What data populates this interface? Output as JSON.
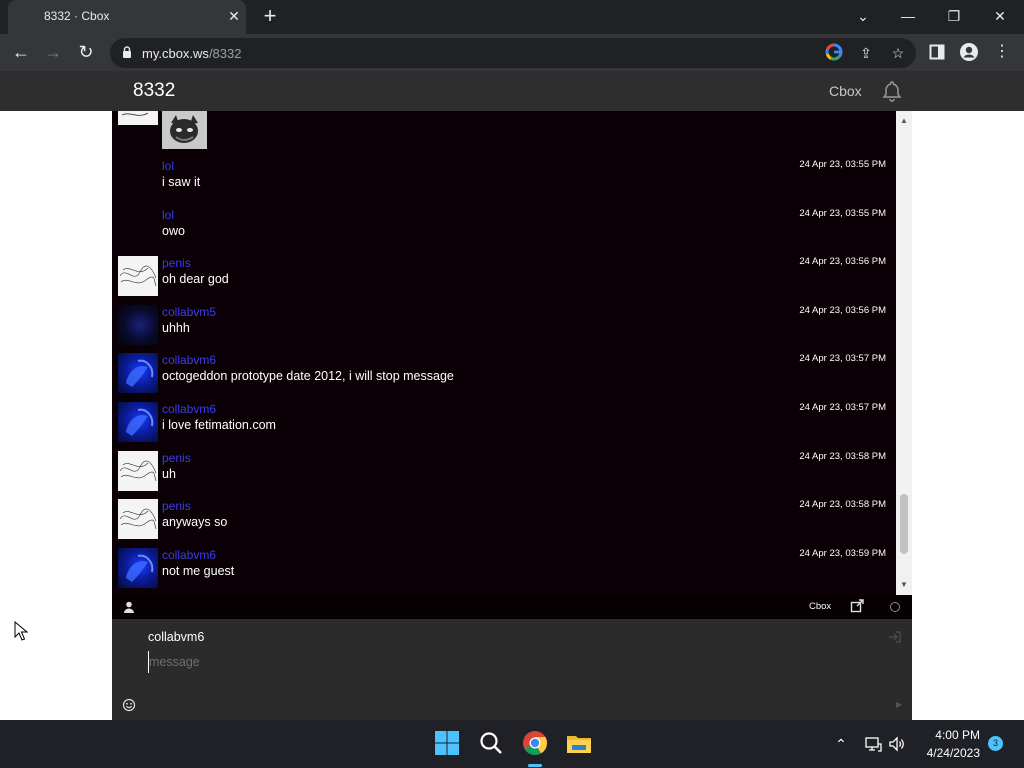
{
  "browser": {
    "tab_title": "8332 · Cbox",
    "url_host": "my.cbox.ws",
    "url_path": "/8332"
  },
  "header": {
    "room_title": "8332",
    "brand_link": "Cbox"
  },
  "messages": [
    {
      "user": "lol",
      "text": "i saw it",
      "time": "24 Apr 23, 03:55 PM",
      "avatar": "none"
    },
    {
      "user": "lol",
      "text": "owo",
      "time": "24 Apr 23, 03:55 PM",
      "avatar": "none"
    },
    {
      "user": "penis",
      "text": "oh dear god",
      "time": "24 Apr 23, 03:56 PM",
      "avatar": "scribble"
    },
    {
      "user": "collabvm5",
      "text": "uhhh",
      "time": "24 Apr 23, 03:56 PM",
      "avatar": "dark"
    },
    {
      "user": "collabvm6",
      "text": "octogeddon prototype date 2012, i will stop message",
      "time": "24 Apr 23, 03:57 PM",
      "avatar": "blue"
    },
    {
      "user": "collabvm6",
      "text": "i love fetimation.com",
      "time": "24 Apr 23, 03:57 PM",
      "avatar": "blue"
    },
    {
      "user": "penis",
      "text": "uh",
      "time": "24 Apr 23, 03:58 PM",
      "avatar": "scribble"
    },
    {
      "user": "penis",
      "text": "anyways so",
      "time": "24 Apr 23, 03:58 PM",
      "avatar": "scribble"
    },
    {
      "user": "collabvm6",
      "text": "not me guest",
      "time": "24 Apr 23, 03:59 PM",
      "avatar": "blue"
    }
  ],
  "scroll_position": 0.95,
  "chat_footer": {
    "brand": "Cbox"
  },
  "compose": {
    "username": "collabvm6",
    "placeholder": "message"
  },
  "taskbar": {
    "time": "4:00 PM",
    "date": "4/24/2023",
    "notification_count": "3"
  },
  "colors": {
    "chat_background": "#0b0005",
    "username": "#3b3bf0",
    "header_background": "#2e2e2e",
    "compose_background": "#2b2b2b"
  }
}
